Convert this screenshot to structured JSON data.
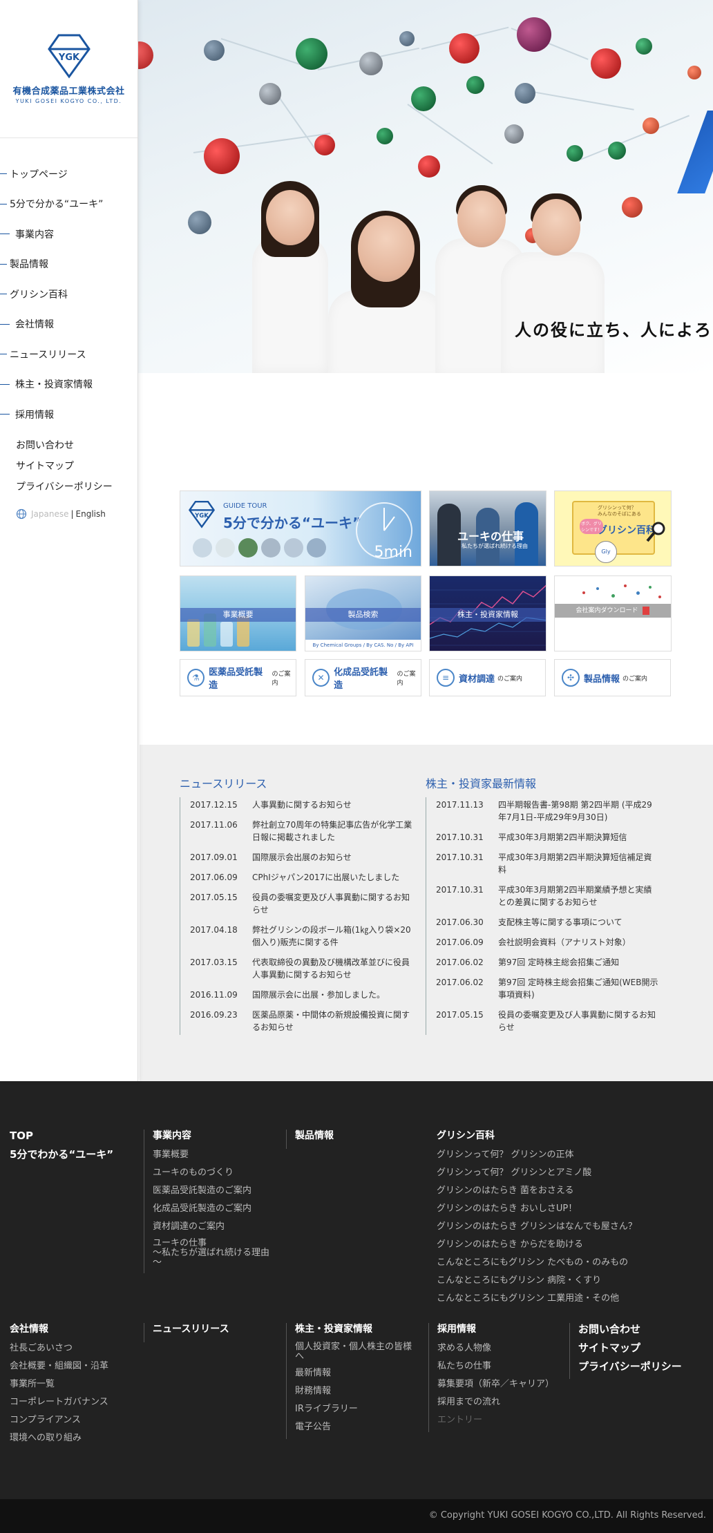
{
  "logo": {
    "mark": "YGK",
    "name": "有機合成薬品工業株式会社",
    "sub": "YUKI GOSEI KOGYO CO., LTD."
  },
  "nav": [
    "トップページ",
    "5分で分かる“ユーキ”",
    "事業内容",
    "製品情報",
    "グリシン百科",
    "会社情報",
    "ニュースリリース",
    "株主・投資家情報",
    "採用情報"
  ],
  "subnav": [
    "お問い合わせ",
    "サイトマップ",
    "プライバシーポリシー"
  ],
  "lang": {
    "japanese": "Japanese",
    "sep": "|",
    "english": "English"
  },
  "hero": {
    "tagline": "人の役に立ち、人によろ"
  },
  "tiles": {
    "guide": {
      "small": "GUIDE TOUR",
      "title": "5分で分かる“ユーキ”",
      "mark": "YGK",
      "min": "5min"
    },
    "work": {
      "title": "ユーキの仕事",
      "sub": "私たちが選ばれ続ける理由"
    },
    "glycine": {
      "title": "グリシン百科",
      "top": "グリシンって何？\nみんなのそばにある",
      "bubble": "ボク、グリシンです！",
      "char": "Gly"
    },
    "business": {
      "label": "事業概要"
    },
    "search": {
      "label": "製品検索",
      "foot": "By Chemical Groups / By CAS. No / By API"
    },
    "ir": {
      "label": "株主・投資家情報"
    },
    "download": {
      "label": "会社案内ダウンロード"
    }
  },
  "buttons": [
    {
      "main": "医薬品受託製造",
      "sm": "のご案内",
      "icon": "flask-icon",
      "glyph": "⚗"
    },
    {
      "main": "化成品受託製造",
      "sm": "のご案内",
      "icon": "tools-icon",
      "glyph": "✕"
    },
    {
      "main": "資材調達",
      "sm": "のご案内",
      "icon": "document-icon",
      "glyph": "≡"
    },
    {
      "main": "製品情報",
      "sm": "のご案内",
      "icon": "molecule-icon",
      "glyph": "✣"
    }
  ],
  "news": {
    "title": "ニュースリリース",
    "items": [
      {
        "date": "2017.12.15",
        "text": "人事異動に関するお知らせ"
      },
      {
        "date": "2017.11.06",
        "text": "弊社創立70周年の特集記事広告が化学工業日報に掲載されました"
      },
      {
        "date": "2017.09.01",
        "text": "国際展示会出展のお知らせ"
      },
      {
        "date": "2017.06.09",
        "text": "CPhIジャパン2017に出展いたしました"
      },
      {
        "date": "2017.05.15",
        "text": "役員の委嘱変更及び人事異動に関するお知らせ"
      },
      {
        "date": "2017.04.18",
        "text": "弊社グリシンの段ボール箱(1㎏入り袋×20個入り)販売に関する件"
      },
      {
        "date": "2017.03.15",
        "text": "代表取締役の異動及び機構改革並びに役員人事異動に関するお知らせ"
      },
      {
        "date": "2016.11.09",
        "text": "国際展示会に出展・参加しました。"
      },
      {
        "date": "2016.09.23",
        "text": "医薬品原薬・中間体の新規設備投資に関するお知らせ"
      }
    ]
  },
  "ir": {
    "title": "株主・投資家最新情報",
    "items": [
      {
        "date": "2017.11.13",
        "text": "四半期報告書-第98期 第2四半期 (平成29年7月1日-平成29年9月30日)"
      },
      {
        "date": "2017.10.31",
        "text": "平成30年3月期第2四半期決算短信"
      },
      {
        "date": "2017.10.31",
        "text": "平成30年3月期第2四半期決算短信補足資料"
      },
      {
        "date": "2017.10.31",
        "text": "平成30年3月期第2四半期業績予想と実績との差異に関するお知らせ"
      },
      {
        "date": "2017.06.30",
        "text": "支配株主等に関する事項について"
      },
      {
        "date": "2017.06.09",
        "text": "会社説明会資料（アナリスト対象）"
      },
      {
        "date": "2017.06.02",
        "text": "第97回 定時株主総会招集ご通知"
      },
      {
        "date": "2017.06.02",
        "text": "第97回 定時株主総会招集ご通知(WEB開示事項資料)"
      },
      {
        "date": "2017.05.15",
        "text": "役員の委嘱変更及び人事異動に関するお知らせ"
      }
    ]
  },
  "footer": {
    "top": {
      "items": [
        "TOP",
        "5分でわかる“ユーキ”"
      ]
    },
    "business": {
      "head": "事業内容",
      "items": [
        "事業概要",
        "ユーキのものづくり",
        "医薬品受託製造のご案内",
        "化成品受託製造のご案内",
        "資材調達のご案内",
        "ユーキの仕事\n～私たちが選ばれ続ける理由\n～"
      ]
    },
    "products": {
      "head": "製品情報"
    },
    "glycine": {
      "head": "グリシン百科",
      "items": [
        "グリシンって何？ グリシンの正体",
        "グリシンって何？ グリシンとアミノ酸",
        "グリシンのはたらき 菌をおさえる",
        "グリシンのはたらき おいしさUP！",
        "グリシンのはたらき グリシンはなんでも屋さん？",
        "グリシンのはたらき からだを助ける",
        "こんなところにもグリシン たべもの・のみもの",
        "こんなところにもグリシン 病院・くすり",
        "こんなところにもグリシン 工業用途・その他"
      ]
    },
    "company": {
      "head": "会社情報",
      "items": [
        "社長ごあいさつ",
        "会社概要・組織図・沿革",
        "事業所一覧",
        "コーポレートガバナンス",
        "コンプライアンス",
        "環境への取り組み"
      ]
    },
    "news": {
      "head": "ニュースリリース"
    },
    "investors": {
      "head": "株主・投資家情報",
      "items": [
        "個人投資家・個人株主の皆様\nへ",
        "最新情報",
        "財務情報",
        "IRライブラリー",
        "電子公告"
      ]
    },
    "recruit": {
      "head": "採用情報",
      "items": [
        "求める人物像",
        "私たちの仕事",
        "募集要項（新卒／キャリア）",
        "採用までの流れ"
      ],
      "disabled": "エントリー"
    },
    "contact": {
      "items": [
        "お問い合わせ",
        "サイトマップ",
        "プライバシーポリシー"
      ]
    }
  },
  "copyright": "© Copyright YUKI GOSEI KOGYO CO.,LTD. All Rights Reserved.",
  "colors": {
    "brand": "#1a55a0",
    "link": "#2c5fae",
    "footer_bg": "#222222"
  }
}
